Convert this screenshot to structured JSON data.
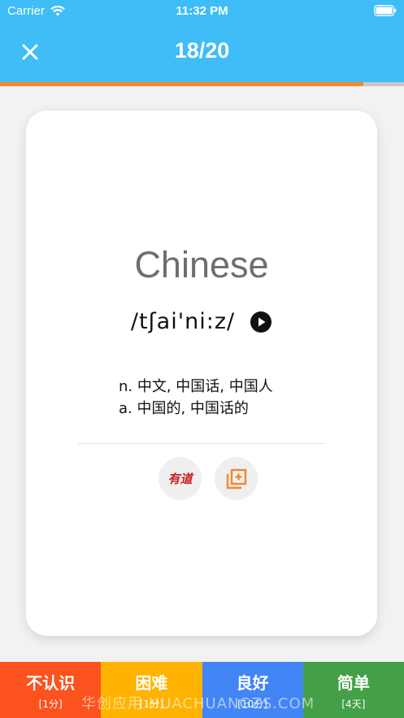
{
  "status_bar": {
    "carrier": "Carrier",
    "time": "11:32 PM"
  },
  "nav": {
    "title": "18/20",
    "progress_fraction": 0.9
  },
  "card": {
    "word": "Chinese",
    "phonetic": "/tʃai'ni:z/",
    "definitions": [
      "n. 中文, 中国话, 中国人",
      "a. 中国的, 中国话的"
    ],
    "youdao_label": "有道"
  },
  "ratings": [
    {
      "label": "不认识",
      "sub": "[1分]",
      "color": "#fc521e"
    },
    {
      "label": "困难",
      "sub": "[1分]",
      "color": "#ffb300"
    },
    {
      "label": "良好",
      "sub": "[10分]",
      "color": "#4285f4"
    },
    {
      "label": "简单",
      "sub": "[4天]",
      "color": "#43a047"
    }
  ],
  "watermark": "华创应用 HUACHUANGZS.COM",
  "colors": {
    "header": "#3ebdf6",
    "progress": "#f08a2a",
    "add_icon": "#f08a2a"
  },
  "icons": [
    "wifi-icon",
    "battery-icon",
    "close-icon",
    "play-icon",
    "add-to-list-icon"
  ]
}
